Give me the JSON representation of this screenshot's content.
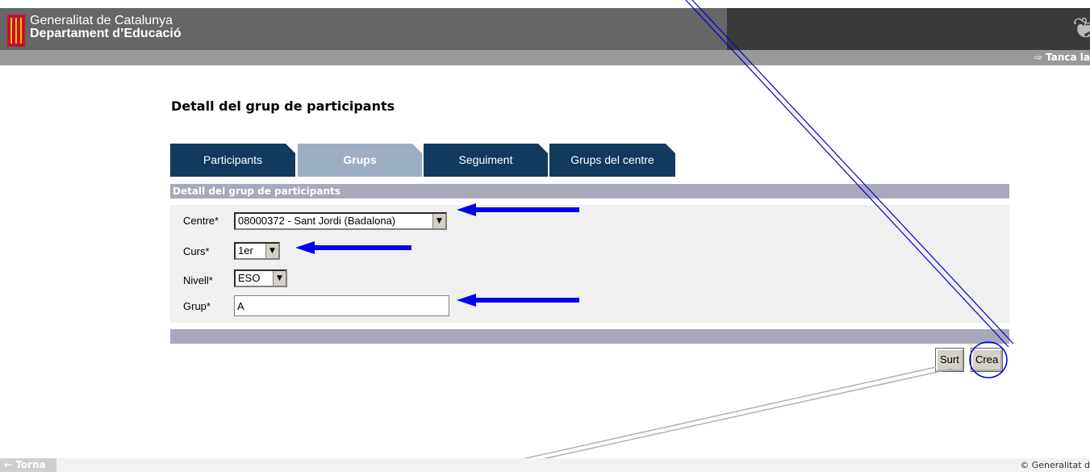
{
  "header": {
    "org_line1": "Generalitat de Catalunya",
    "org_line2": "Departament d’Educació",
    "logout_label": "Tanca la",
    "logout_icon": "exit-icon"
  },
  "page_title": "Detall del grup de participants",
  "tabs": [
    {
      "label": "Participants",
      "active": false
    },
    {
      "label": "Grups",
      "active": true
    },
    {
      "label": "Seguiment",
      "active": false
    },
    {
      "label": "Grups del centre",
      "active": false
    }
  ],
  "form": {
    "section_title": "Detall del grup de participants",
    "centre": {
      "label": "Centre*",
      "value": "08000372 - Sant Jordi (Badalona)"
    },
    "curs": {
      "label": "Curs*",
      "value": "1er"
    },
    "nivell": {
      "label": "Nivell*",
      "value": "ESO"
    },
    "grup": {
      "label": "Grup*",
      "value": "A"
    }
  },
  "buttons": {
    "surt": "Surt",
    "crea": "Crea"
  },
  "footer": {
    "back_label": "← Torna",
    "copyright": "© Generalitat d"
  },
  "colors": {
    "tab_dark": "#123a5e",
    "tab_active": "#9caec5",
    "annotation": "#0000ee"
  }
}
